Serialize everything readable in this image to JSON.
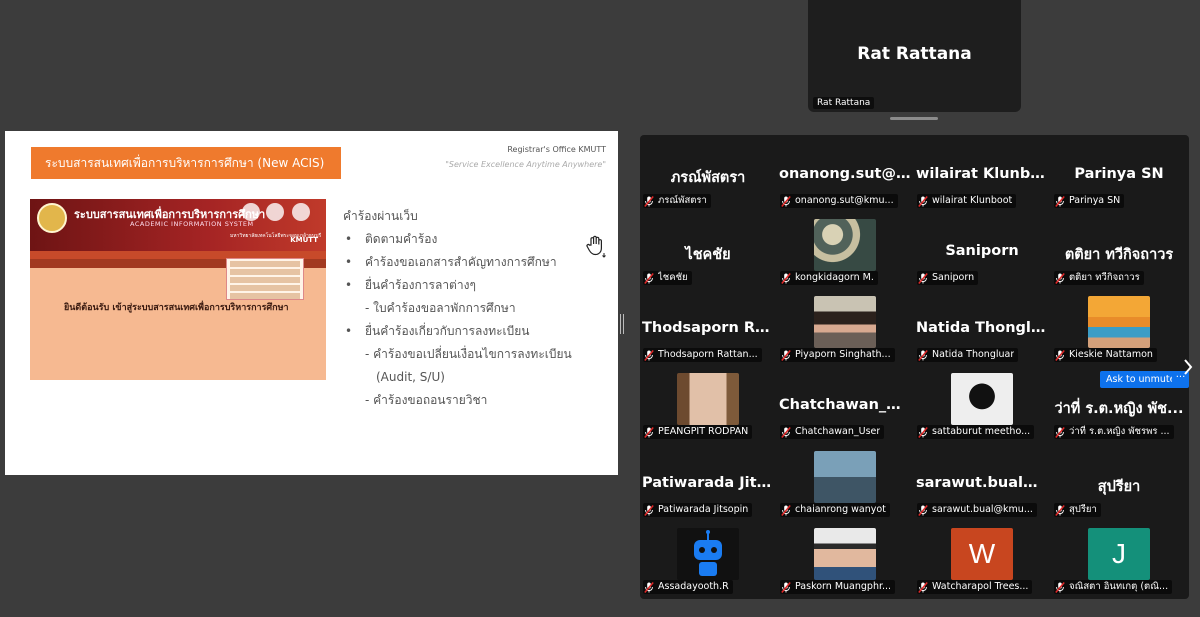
{
  "speaker": {
    "name_big": "Rat Rattana",
    "name_label": "Rat Rattana"
  },
  "slide": {
    "title": "ระบบสารสนเทศเพื่อการบริหารการศึกษา (New ACIS)",
    "registrar": "Registrar's Office KMUTT",
    "tagline": "\"Service Excellence Anytime Anywhere\"",
    "image": {
      "header_thai": "ระบบสารสนเทศเพื่อการบริหารการศึกษา",
      "header_en": "ACADEMIC INFORMATION SYSTEM",
      "university": "มหาวิทยาลัยเทคโนโลยีพระจอมเกล้าธนบุรี",
      "kmutt": "KMUTT",
      "welcome": "ยินดีต้อนรับ เข้าสู่ระบบสารสนเทศเพื่อการบริหารการศึกษา"
    },
    "bullets": {
      "heading": "คำร้องผ่านเว็บ",
      "b1": "ติดตามคำร้อง",
      "b2": "คำร้องขอเอกสารสำคัญทางการศึกษา",
      "b3": "ยื่นคำร้องการลาต่างๆ",
      "b3a": "- ใบคำร้องขอลาพักการศึกษา",
      "b4": "ยื่นคำร้องเกี่ยวกับการลงทะเบียน",
      "b4a": "- คำร้องขอเปลี่ยนเงื่อนไขการลงทะเบียน",
      "b4a2": "(Audit, S/U)",
      "b4b": "- คำร้องขอถอนรายวิชา",
      "dot": "•"
    }
  },
  "gallery": {
    "tiles": [
      {
        "big": "ภรณ์พัสตรา",
        "label": "ภรณ์พัสตรา"
      },
      {
        "big": "onanong.sut@k...",
        "label": "onanong.sut@kmu..."
      },
      {
        "big": "wilairat Klunboot",
        "label": "wilairat Klunboot"
      },
      {
        "big": "Parinya SN",
        "label": "Parinya SN"
      },
      {
        "big": "ไชคชัย",
        "label": "ไชคชัย"
      },
      {
        "big": "",
        "label": "kongkidagorn M."
      },
      {
        "big": "Saniporn",
        "label": "Saniporn"
      },
      {
        "big": "ตติยา ทวีกิจถาวร",
        "label": "ตติยา ทวีกิจถาวร"
      },
      {
        "big": "Thodsaporn  Rat...",
        "label": "Thodsaporn Rattan..."
      },
      {
        "big": "",
        "label": "Piyaporn Singhath..."
      },
      {
        "big": "Natida Thongluar",
        "label": "Natida Thongluar"
      },
      {
        "big": "",
        "label": "Kieskie Nattamon"
      },
      {
        "big": "",
        "label": "PEANGPIT RODPAN"
      },
      {
        "big": "Chatchawan_User",
        "label": "Chatchawan_User"
      },
      {
        "big": "",
        "label": "sattaburut meetho..."
      },
      {
        "big": "ว่าที่ ร.ต.หญิง พัช...",
        "label": "ว่าที่ ร.ต.หญิง พัชรพร ..."
      },
      {
        "big": "Patiwarada  Jits...",
        "label": "Patiwarada Jitsopin"
      },
      {
        "big": "",
        "label": "chaianrong wanyot"
      },
      {
        "big": "sarawut.bual@k...",
        "label": "sarawut.bual@kmu..."
      },
      {
        "big": "สุปรียา",
        "label": "สุปรียา"
      },
      {
        "big": "",
        "label": "Assadayooth.R"
      },
      {
        "big": "",
        "label": "Paskorn Muangphr..."
      },
      {
        "big": "",
        "label": "Watcharapol Trees..."
      },
      {
        "big": "",
        "label": "จณิสตา อินทเกตุ (ตณิ..."
      }
    ],
    "avatar_letters": {
      "w": "W",
      "j": "J"
    },
    "unmute_label": "Ask to unmute",
    "more_label": "···"
  },
  "colors": {
    "slide_title_bg": "#ef7a2d",
    "unmute_bg": "#0e72ed",
    "gallery_bg": "#1a1a1a",
    "muted_mic": "#e02828"
  }
}
